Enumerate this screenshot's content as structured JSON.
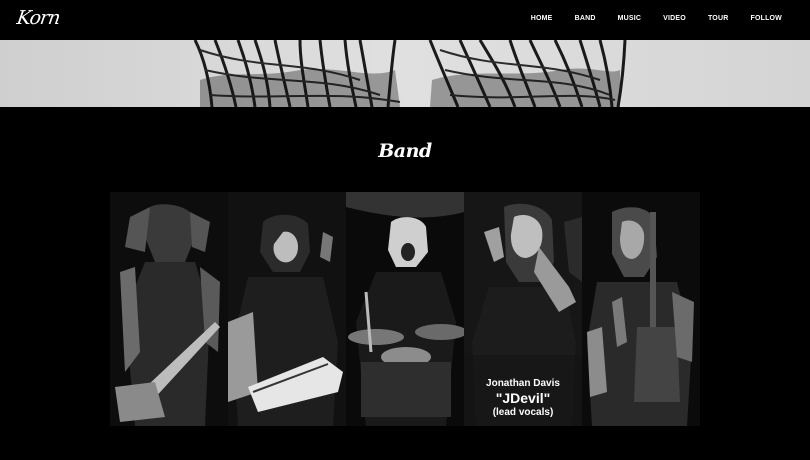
{
  "header": {
    "logo_text": "Korn",
    "nav": [
      {
        "label": "HOME"
      },
      {
        "label": "BAND"
      },
      {
        "label": "MUSIC"
      },
      {
        "label": "VIDEO"
      },
      {
        "label": "TOUR"
      },
      {
        "label": "FOLLOW"
      }
    ]
  },
  "band": {
    "title": "Band",
    "featured": {
      "name": "Jonathan Davis",
      "nickname": "\"JDevil\"",
      "role": "(lead vocals)"
    }
  },
  "colors": {
    "background": "#000000",
    "hero": "#d8d8d8",
    "text": "#ffffff"
  }
}
